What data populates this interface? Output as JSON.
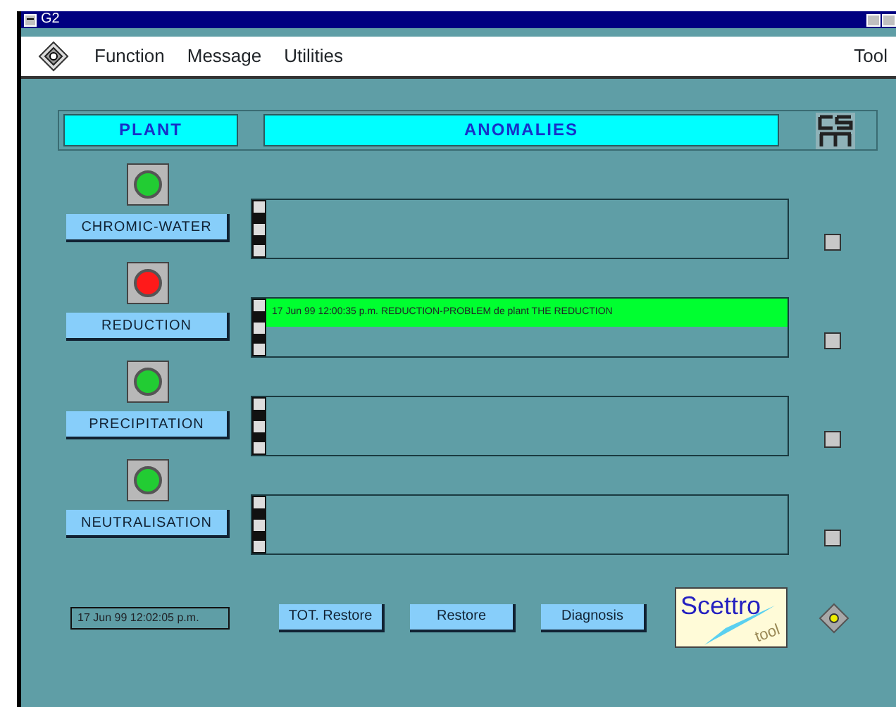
{
  "window": {
    "title": "G2"
  },
  "menu": {
    "items": [
      "Function",
      "Message",
      "Utilities"
    ],
    "right": "Tool"
  },
  "header": {
    "plant": "PLANT",
    "anomalies": "ANOMALIES"
  },
  "plants": [
    {
      "name": "CHROMIC-WATER",
      "alarm": false,
      "checked": false
    },
    {
      "name": "REDUCTION",
      "alarm": true,
      "anomalies": [
        "17 Jun 99  12:00:35 p.m. REDUCTION-PROBLEM   de plant THE REDUCTION"
      ],
      "checked": false
    },
    {
      "name": "PRECIPITATION",
      "alarm": false,
      "checked": false
    },
    {
      "name": "NEUTRALISATION",
      "alarm": false,
      "checked": false
    }
  ],
  "clock": "17 Jun 99  12:02:05 p.m.",
  "buttons": [
    "TOT. Restore",
    "Restore",
    "Diagnosis"
  ],
  "logo": {
    "main": "Scettro",
    "sub": "tool"
  }
}
